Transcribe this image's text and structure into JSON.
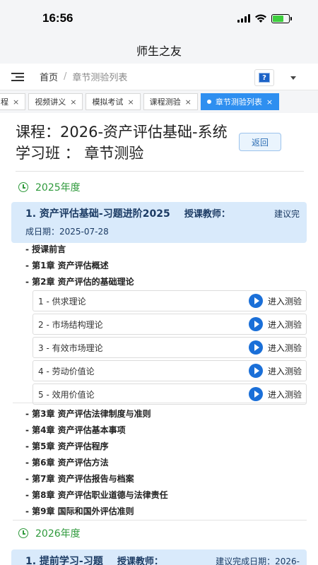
{
  "status": {
    "time": "16:56"
  },
  "app_title": "师生之友",
  "nav": {
    "home": "首页",
    "separator": "/",
    "current": "章节测验列表",
    "help_label": "?"
  },
  "tabs": [
    {
      "label": "程",
      "active": false
    },
    {
      "label": "视频讲义",
      "active": false
    },
    {
      "label": "模拟考试",
      "active": false
    },
    {
      "label": "课程测验",
      "active": false
    },
    {
      "label": "章节测验列表",
      "active": true
    }
  ],
  "page": {
    "title": "课程：2026-资产评估基础-系统学习班 ： 章节测验",
    "back_label": "返回"
  },
  "years": [
    {
      "label": "2025年度",
      "course": {
        "name": "1. 资产评估基础-习题进阶2025",
        "teacher": "授课教师：",
        "due_prefix": "建议完",
        "due_rest": "成日期：2025-07-28"
      },
      "chapters_before": [
        "- 授课前言",
        "- 第1章 资产评估概述",
        "- 第2章 资产评估的基础理论"
      ],
      "sections": [
        {
          "label": "1 - 供求理论",
          "action": "进入测验"
        },
        {
          "label": "2 - 市场结构理论",
          "action": "进入测验"
        },
        {
          "label": "3 - 有效市场理论",
          "action": "进入测验"
        },
        {
          "label": "4 - 劳动价值论",
          "action": "进入测验"
        },
        {
          "label": "5 - 效用价值论",
          "action": "进入测验"
        }
      ],
      "chapters_after": [
        "- 第3章 资产评估法律制度与准则",
        "- 第4章 资产评估基本事项",
        "- 第5章 资产评估程序",
        "- 第6章 资产评估方法",
        "- 第7章 资产评估报告与档案",
        "- 第8章 资产评估职业道德与法律责任",
        "- 第9章 国际和国外评估准则"
      ]
    },
    {
      "label": "2026年度",
      "course": {
        "name": "1. 提前学习-习题",
        "teacher": "授课教师：",
        "due_prefix": "建议完成日期：2026-"
      }
    }
  ]
}
